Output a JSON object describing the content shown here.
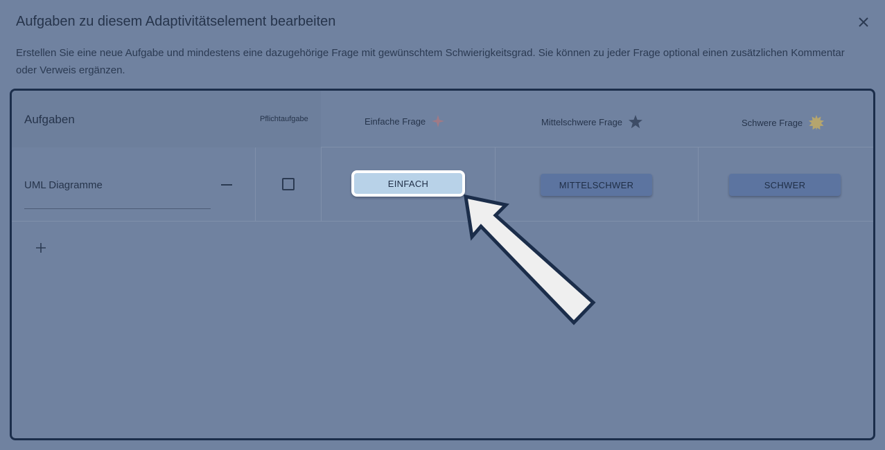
{
  "dialog": {
    "title": "Aufgaben zu diesem Adaptivitätselement bearbeiten",
    "description": "Erstellen Sie eine neue Aufgabe und mindestens eine dazugehörige Frage mit gewünschtem Schwierigkeitsgrad. Sie können zu jeder Frage optional einen zusätzlichen Kommentar oder Verweis ergänzen."
  },
  "table": {
    "headers": {
      "tasks": "Aufgaben",
      "mandatory": "Pflichtaufgabe",
      "easy": "Einfache Frage",
      "medium": "Mittelschwere Frage",
      "hard": "Schwere Frage"
    },
    "rows": [
      {
        "task_name": "UML Diagramme",
        "mandatory": false,
        "easy_button": "EINFACH",
        "medium_button": "MITTELSCHWER",
        "hard_button": "SCHWER"
      }
    ]
  },
  "icons": {
    "close": "close-icon",
    "easy": "four-point-star-icon",
    "medium": "star-icon",
    "hard": "sun-star-icon",
    "remove": "minus-icon",
    "add": "plus-icon"
  },
  "colors": {
    "easy_star": "#a07a86",
    "medium_star": "#3d4c66",
    "hard_star": "#b5a56e",
    "highlight_button": "#b8d2e8",
    "button": "#5c74a0"
  }
}
